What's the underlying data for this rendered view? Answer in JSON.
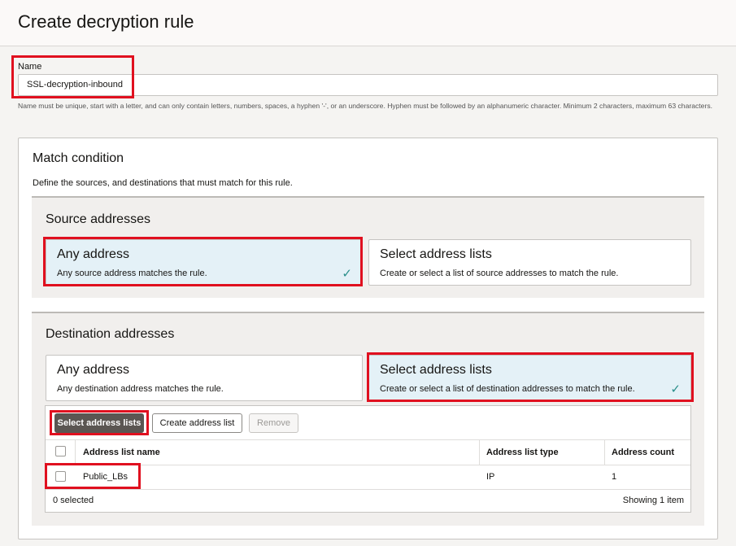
{
  "page": {
    "title": "Create decryption rule"
  },
  "name_field": {
    "label": "Name",
    "value": "SSL-decryption-inbound",
    "hint": "Name must be unique, start with a letter, and can only contain letters, numbers, spaces, a hyphen '-', or an underscore. Hyphen must be followed by an alphanumeric character. Minimum 2 characters, maximum 63 characters."
  },
  "match": {
    "title": "Match condition",
    "description": "Define the sources, and destinations that must match for this rule."
  },
  "source": {
    "title": "Source addresses",
    "options": [
      {
        "title": "Any address",
        "desc": "Any source address matches the rule.",
        "selected": true
      },
      {
        "title": "Select address lists",
        "desc": "Create or select a list of source addresses to match the rule.",
        "selected": false
      }
    ]
  },
  "destination": {
    "title": "Destination addresses",
    "options": [
      {
        "title": "Any address",
        "desc": "Any destination address matches the rule.",
        "selected": false
      },
      {
        "title": "Select address lists",
        "desc": "Create or select a list of destination addresses to match the rule.",
        "selected": true
      }
    ]
  },
  "toolbar": {
    "select_label": "Select address lists",
    "create_label": "Create address list",
    "remove_label": "Remove"
  },
  "table": {
    "columns": [
      "Address list name",
      "Address list type",
      "Address count"
    ],
    "rows": [
      {
        "name": "Public_LBs",
        "type": "IP",
        "count": "1"
      }
    ],
    "footer_selected": "0 selected",
    "footer_showing": "Showing 1 item"
  },
  "colors": {
    "accent_red": "#e0101f",
    "selected_bg": "#e4f1f7",
    "check": "#2a8f8a"
  }
}
